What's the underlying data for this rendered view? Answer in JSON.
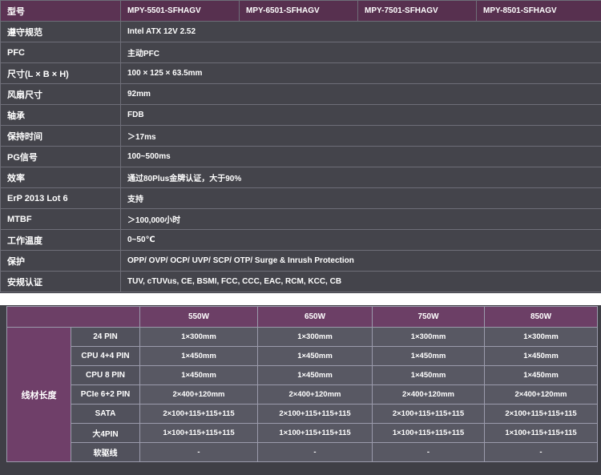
{
  "spec": {
    "model_label": "型号",
    "models": [
      "MPY-5501-SFHAGV",
      "MPY-6501-SFHAGV",
      "MPY-7501-SFHAGV",
      "MPY-8501-SFHAGV"
    ],
    "rows": [
      {
        "label": "遵守规范",
        "value": "Intel ATX 12V 2.52"
      },
      {
        "label": "PFC",
        "value": "主动PFC"
      },
      {
        "label": "尺寸(L × B × H)",
        "value": "100 × 125 × 63.5mm"
      },
      {
        "label": "风扇尺寸",
        "value": "92mm"
      },
      {
        "label": "轴承",
        "value": "FDB"
      },
      {
        "label": "保持时间",
        "value": "＞17ms"
      },
      {
        "label": "PG信号",
        "value": "100~500ms"
      },
      {
        "label": "效率",
        "value": "通过80Plus金牌认证，大于90%"
      },
      {
        "label": "ErP 2013 Lot 6",
        "value": "支持"
      },
      {
        "label": "MTBF",
        "value": "＞100,000小时"
      },
      {
        "label": "工作温度",
        "value": "0~50℃"
      },
      {
        "label": "保护",
        "value": "OPP/ OVP/ OCP/ UVP/ SCP/ OTP/ Surge & Inrush Protection"
      },
      {
        "label": "安规认证",
        "value": "TUV, cTUVus, CE, BSMI, FCC, CCC, EAC, RCM, KCC, CB"
      }
    ]
  },
  "cables": {
    "side_label": "线材长度",
    "wattages": [
      "550W",
      "650W",
      "750W",
      "850W"
    ],
    "rows": [
      {
        "name": "24 PIN",
        "values": [
          "1×300mm",
          "1×300mm",
          "1×300mm",
          "1×300mm"
        ]
      },
      {
        "name": "CPU 4+4 PIN",
        "values": [
          "1×450mm",
          "1×450mm",
          "1×450mm",
          "1×450mm"
        ]
      },
      {
        "name": "CPU 8 PIN",
        "values": [
          "1×450mm",
          "1×450mm",
          "1×450mm",
          "1×450mm"
        ]
      },
      {
        "name": "PCIe 6+2 PIN",
        "values": [
          "2×400+120mm",
          "2×400+120mm",
          "2×400+120mm",
          "2×400+120mm"
        ]
      },
      {
        "name": "SATA",
        "values": [
          "2×100+115+115+115",
          "2×100+115+115+115",
          "2×100+115+115+115",
          "2×100+115+115+115"
        ]
      },
      {
        "name": "大4PIN",
        "values": [
          "1×100+115+115+115",
          "1×100+115+115+115",
          "1×100+115+115+115",
          "1×100+115+115+115"
        ]
      },
      {
        "name": "软驱线",
        "values": [
          "-",
          "-",
          "-",
          "-"
        ]
      }
    ]
  }
}
